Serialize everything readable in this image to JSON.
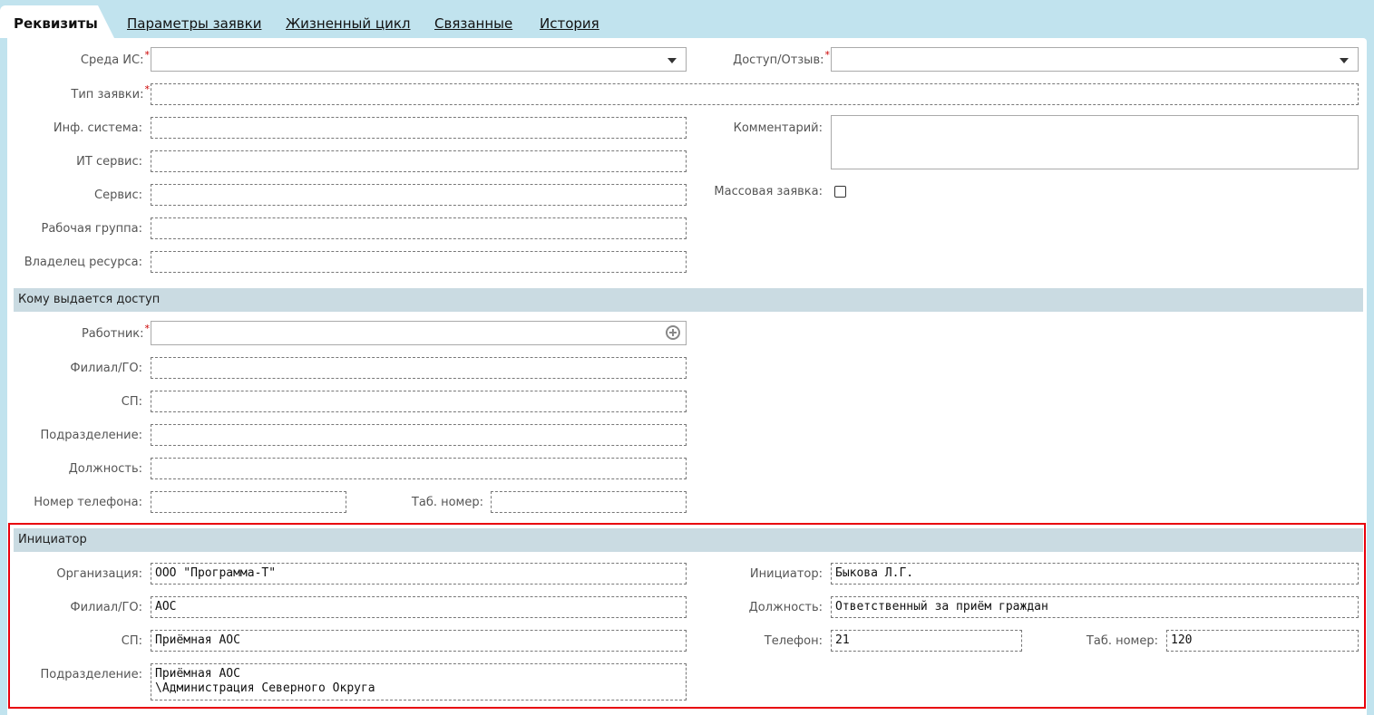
{
  "tabs": {
    "requisites": "Реквизиты",
    "params": "Параметры заявки",
    "lifecycle": "Жизненный цикл",
    "related": "Связанные",
    "history": "История"
  },
  "general": {
    "env_label": "Среда ИС:",
    "access_label": "Доступ/Отзыв:",
    "type_label": "Тип заявки:",
    "infsys_label": "Инф. система:",
    "itservice_label": "ИТ сервис:",
    "service_label": "Сервис:",
    "workgroup_label": "Рабочая группа:",
    "owner_label": "Владелец ресурса:",
    "comment_label": "Комментарий:",
    "mass_label": "Массовая заявка:",
    "required_mark": "*"
  },
  "access_section": {
    "title": "Кому выдается доступ",
    "employee_label": "Работник:",
    "branch_label": "Филиал/ГО:",
    "sp_label": "СП:",
    "subdivision_label": "Подразделение:",
    "position_label": "Должность:",
    "phone_label": "Номер телефона:",
    "tabnum_label": "Таб. номер:"
  },
  "initiator_section": {
    "title": "Инициатор",
    "org_label": "Организация:",
    "org_value": "ООО \"Программа-Т\"",
    "branch_label": "Филиал/ГО:",
    "branch_value": "АОС",
    "sp_label": "СП:",
    "sp_value": "Приёмная АОС",
    "subdivision_label": "Подразделение:",
    "subdivision_value": "Приёмная АОС\n\\Администрация Северного Округа",
    "initiator_label": "Инициатор:",
    "initiator_value": "Быкова Л.Г.",
    "position_label": "Должность:",
    "position_value": "Ответственный за приём граждан",
    "phone_label": "Телефон:",
    "phone_value": "21",
    "tabnum_label": "Таб. номер:",
    "tabnum_value": "120"
  },
  "icons": {
    "dropdown": "chevron-down-icon",
    "add": "plus-circle-icon"
  },
  "colors": {
    "background": "#c1e3ee",
    "section_header": "#cadbe2",
    "highlight_border": "#e8000b",
    "required": "#cc0000"
  }
}
